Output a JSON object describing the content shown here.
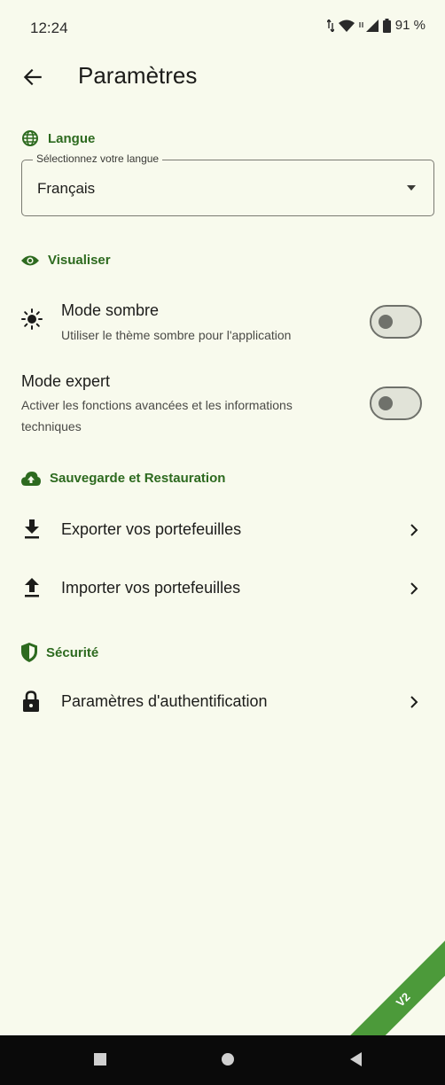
{
  "status_bar": {
    "time": "12:24",
    "battery": "91 %"
  },
  "app_bar": {
    "title": "Paramètres"
  },
  "sections": {
    "langue": {
      "title": "Langue",
      "field_label": "Sélectionnez votre langue",
      "selected": "Français"
    },
    "visualiser": {
      "title": "Visualiser",
      "dark_mode": {
        "title": "Mode sombre",
        "subtitle": "Utiliser le thème sombre pour l'application",
        "enabled": false
      },
      "expert_mode": {
        "title": "Mode expert",
        "subtitle_line1": "Activer les fonctions avancées et les informations",
        "subtitle_line2": "techniques",
        "enabled": false
      }
    },
    "backup": {
      "title": "Sauvegarde et Restauration",
      "export_label": "Exporter vos portefeuilles",
      "import_label": "Importer vos portefeuilles"
    },
    "security": {
      "title": "Sécurité",
      "auth_label": "Paramètres d'authentification"
    }
  },
  "ribbon": {
    "label": "V2"
  },
  "colors": {
    "background": "#f8faed",
    "accent": "#2d6a1f",
    "ribbon": "#4c9a3a",
    "nav_bar": "#0a0a0a"
  },
  "icons": {
    "language": "globe-icon",
    "visualiser": "eye-icon",
    "dark_mode": "brightness-icon",
    "backup": "cloud-upload-icon",
    "export": "download-icon",
    "import": "upload-icon",
    "security": "shield-icon",
    "auth": "lock-icon"
  }
}
